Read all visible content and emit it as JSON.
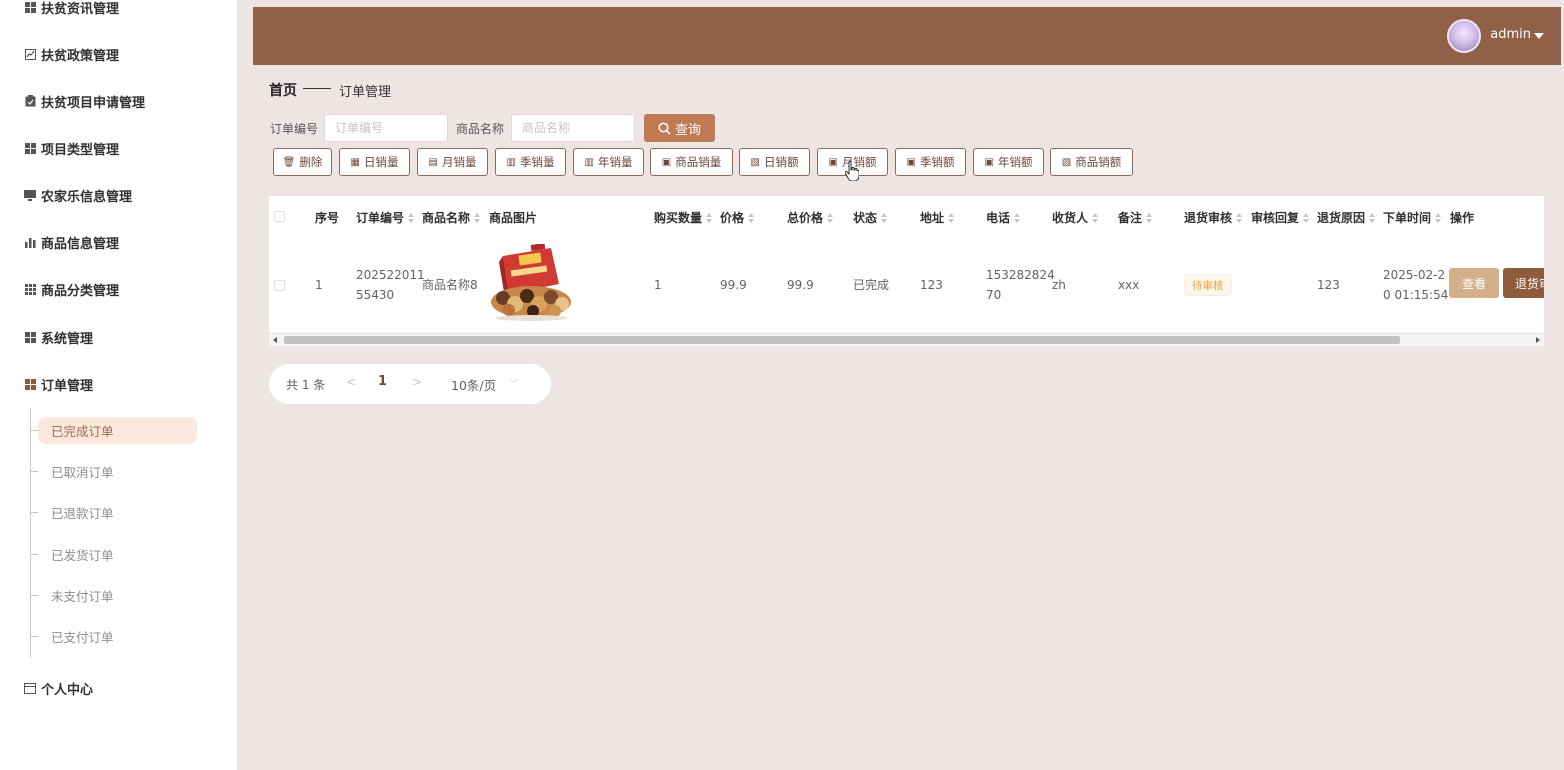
{
  "sidebar": {
    "top_partial": "扶贫资讯管理",
    "items": [
      {
        "label": "扶贫政策管理",
        "icon": "chart-line-icon"
      },
      {
        "label": "扶贫项目申请管理",
        "icon": "clipboard-icon"
      },
      {
        "label": "项目类型管理",
        "icon": "grid-icon"
      },
      {
        "label": "农家乐信息管理",
        "icon": "monitor-icon"
      },
      {
        "label": "商品信息管理",
        "icon": "bar-chart-icon"
      },
      {
        "label": "商品分类管理",
        "icon": "grid-dots-icon"
      },
      {
        "label": "系统管理",
        "icon": "grid-icon"
      },
      {
        "label": "订单管理",
        "icon": "grid-icon"
      }
    ],
    "sub_items": [
      "已完成订单",
      "已取消订单",
      "已退款订单",
      "已发货订单",
      "未支付订单",
      "已支付订单"
    ],
    "active_sub": "已完成订单",
    "profile": "个人中心"
  },
  "header": {
    "username": "admin"
  },
  "breadcrumb": {
    "home": "首页",
    "current": "订单管理"
  },
  "search": {
    "order_no_label": "订单编号",
    "order_no_placeholder": "订单编号",
    "goods_name_label": "商品名称",
    "goods_name_placeholder": "商品名称",
    "query_label": "查询"
  },
  "actions": [
    "删除",
    "日销量",
    "月销量",
    "季销量",
    "年销量",
    "商品销量",
    "日销额",
    "月销额",
    "季销额",
    "年销额",
    "商品销额"
  ],
  "table": {
    "headers": {
      "index": "序号",
      "order_no": "订单编号",
      "goods_name": "商品名称",
      "goods_image": "商品图片",
      "quantity": "购买数量",
      "price": "价格",
      "total": "总价格",
      "status": "状态",
      "address": "地址",
      "phone": "电话",
      "receiver": "收货人",
      "remark": "备注",
      "return_review": "退货审核",
      "review_reply": "审核回复",
      "return_reason": "退货原因",
      "order_time": "下单时间",
      "operation": "操作"
    },
    "rows": [
      {
        "index": "1",
        "order_no_1": "202522011",
        "order_no_2": "55430",
        "goods_name": "商品名称8",
        "quantity": "1",
        "price": "99.9",
        "total": "99.9",
        "status": "已完成",
        "address": "123",
        "phone_1": "153282824",
        "phone_2": "70",
        "receiver": "zh",
        "remark": "xxx",
        "return_review": "待审核",
        "return_reason": "123",
        "order_time_1": "2025-02-2",
        "order_time_2": "0 01:15:54",
        "view_label": "查看",
        "return_label": "退货审核"
      }
    ]
  },
  "pagination": {
    "total": "共 1 条",
    "prev": "<",
    "page": "1",
    "next": ">",
    "page_size": "10条/页"
  },
  "colors": {
    "header": "#906146",
    "accent": "#c27a55",
    "active_bg": "#fbe8dc"
  }
}
